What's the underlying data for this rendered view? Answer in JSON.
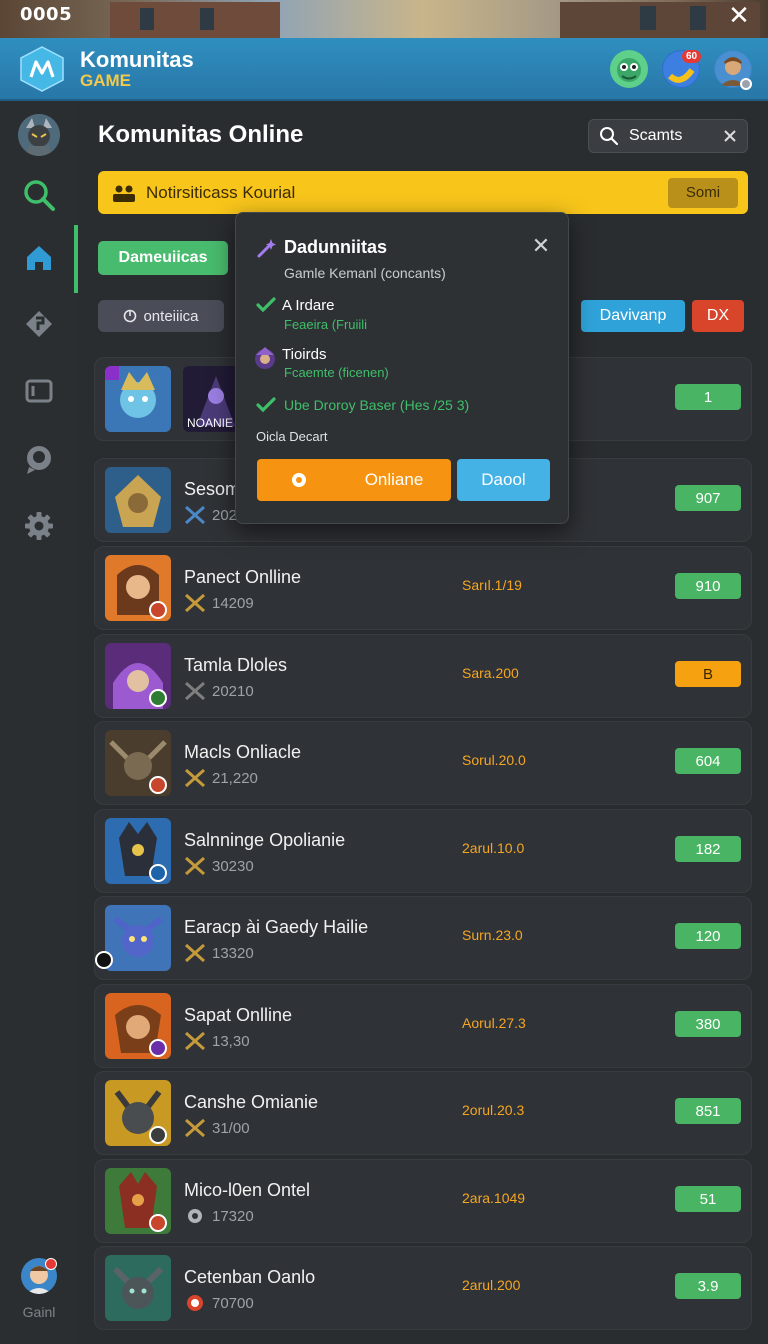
{
  "top_bar": {
    "time": "0005",
    "close_glyph": "✕"
  },
  "header": {
    "title": "Komunitas",
    "subtitle": "GAME",
    "notification_count": "60"
  },
  "sidebar": {
    "items": [
      {
        "icon": "warrior-avatar-icon"
      },
      {
        "icon": "search-icon"
      },
      {
        "icon": "home-icon"
      },
      {
        "icon": "tag-icon"
      },
      {
        "icon": "window-icon"
      },
      {
        "icon": "chat-icon"
      },
      {
        "icon": "gear-icon"
      }
    ],
    "user_label": "Gainl"
  },
  "main": {
    "title": "Komunitas Online",
    "search": {
      "value": "Scamts"
    },
    "notice": {
      "text": "Notirsiticass Kourial",
      "button": "Somi"
    },
    "tab_active": "Dameuiicas",
    "filter_chip": "onteiiica",
    "btn_blue": "Davivanp",
    "btn_red": "DX"
  },
  "popup": {
    "title": "Dadunniitas",
    "subtitle": "Gamle Kemanl (concants)",
    "items": [
      {
        "title": "A Irdare",
        "sub": "Feaeira (Fruiili"
      },
      {
        "title": "Tioirds",
        "sub": "Fcaemte (ficenen)"
      }
    ],
    "check_line": "Ube Droroy Baser (Hes /25 3)",
    "note": "Oicla Decart",
    "primary_button": "Onliane",
    "secondary_button": "Daool",
    "thumb_label": "NOANIE"
  },
  "games": [
    {
      "name": "",
      "meta": "",
      "status": "",
      "count": "1",
      "count_color": "green"
    },
    {
      "name": "Sesom",
      "meta": "2022",
      "status": "",
      "count": "907",
      "count_color": "green"
    },
    {
      "name": "Panect Onlline",
      "meta": "14209",
      "status": "Sarıl.1/19",
      "count": "910",
      "count_color": "green"
    },
    {
      "name": "Tamla Dloles",
      "meta": "20210",
      "status": "Sara.200",
      "count": "B",
      "count_color": "orange"
    },
    {
      "name": "Macls Onliacle",
      "meta": "21,220",
      "status": "Sorul.20.0",
      "count": "604",
      "count_color": "green"
    },
    {
      "name": "Salnninge Opolianie",
      "meta": "30230",
      "status": "2arul.10.0",
      "count": "182",
      "count_color": "green"
    },
    {
      "name": "Earacp ài Gaedy Hailie",
      "meta": "13320",
      "status": "Surn.23.0",
      "count": "120",
      "count_color": "green"
    },
    {
      "name": "Sapat Onlline",
      "meta": "13,30",
      "status": "Aorul.27.3",
      "count": "380",
      "count_color": "green"
    },
    {
      "name": "Canshe Omianie",
      "meta": "31/00",
      "status": "2orul.20.3",
      "count": "851",
      "count_color": "green"
    },
    {
      "name": "Mico-l0en Ontel",
      "meta": "17320",
      "status": "2ara.1049",
      "count": "51",
      "count_color": "green"
    },
    {
      "name": "Cetenban Oanlo",
      "meta": "70700",
      "status": "2arul.200",
      "count": "3.9",
      "count_color": "green"
    }
  ],
  "colors": {
    "accent_green": "#48bb6e",
    "accent_yellow": "#f8c51b",
    "accent_blue": "#2fa3d9",
    "accent_orange": "#f69310",
    "header_blue": "#2877a8"
  }
}
